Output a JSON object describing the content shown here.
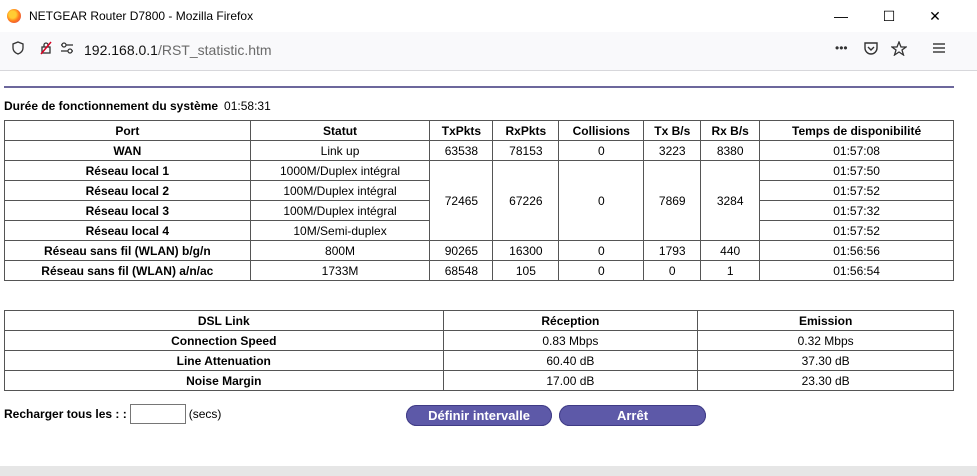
{
  "window": {
    "title": "NETGEAR Router D7800 - Mozilla Firefox",
    "minimize": "—",
    "maximize": "☐",
    "close": "✕"
  },
  "addressbar": {
    "host": "192.168.0.1",
    "path": "/RST_statistic.htm",
    "menu_dots": "•••"
  },
  "uptime": {
    "label": "Durée de fonctionnement du système",
    "value": "01:58:31"
  },
  "stats": {
    "headers": [
      "Port",
      "Statut",
      "TxPkts",
      "RxPkts",
      "Collisions",
      "Tx B/s",
      "Rx B/s",
      "Temps de disponibilité"
    ],
    "wan": {
      "port": "WAN",
      "status": "Link up",
      "tx": "63538",
      "rx": "78153",
      "col": "0",
      "txbs": "3223",
      "rxbs": "8380",
      "up": "01:57:08"
    },
    "lan": {
      "tx": "72465",
      "rx": "67226",
      "col": "0",
      "txbs": "7869",
      "rxbs": "3284",
      "rows": [
        {
          "port": "Réseau local  1",
          "status": "1000M/Duplex intégral",
          "up": "01:57:50"
        },
        {
          "port": "Réseau local  2",
          "status": "100M/Duplex intégral",
          "up": "01:57:52"
        },
        {
          "port": "Réseau local  3",
          "status": "100M/Duplex intégral",
          "up": "01:57:32"
        },
        {
          "port": "Réseau local  4",
          "status": "10M/Semi-duplex",
          "up": "01:57:52"
        }
      ]
    },
    "wlan_bgn": {
      "port": "Réseau sans fil (WLAN) b/g/n",
      "status": "800M",
      "tx": "90265",
      "rx": "16300",
      "col": "0",
      "txbs": "1793",
      "rxbs": "440",
      "up": "01:56:56"
    },
    "wlan_anac": {
      "port": "Réseau sans fil (WLAN) a/n/ac",
      "status": "1733M",
      "tx": "68548",
      "rx": "105",
      "col": "0",
      "txbs": "0",
      "rxbs": "1",
      "up": "01:56:54"
    }
  },
  "dsl": {
    "headers": [
      "DSL Link",
      "Réception",
      "Emission"
    ],
    "rows": [
      {
        "label": "Connection Speed",
        "rx": "0.83 Mbps",
        "tx": "0.32 Mbps"
      },
      {
        "label": "Line Attenuation",
        "rx": "60.40 dB",
        "tx": "37.30 dB"
      },
      {
        "label": "Noise Margin",
        "rx": "17.00 dB",
        "tx": "23.30 dB"
      }
    ]
  },
  "controls": {
    "reload_label": "Recharger tous les : :",
    "reload_value": "",
    "secs": "(secs)",
    "set_interval": "Définir intervalle",
    "stop": "Arrêt"
  }
}
